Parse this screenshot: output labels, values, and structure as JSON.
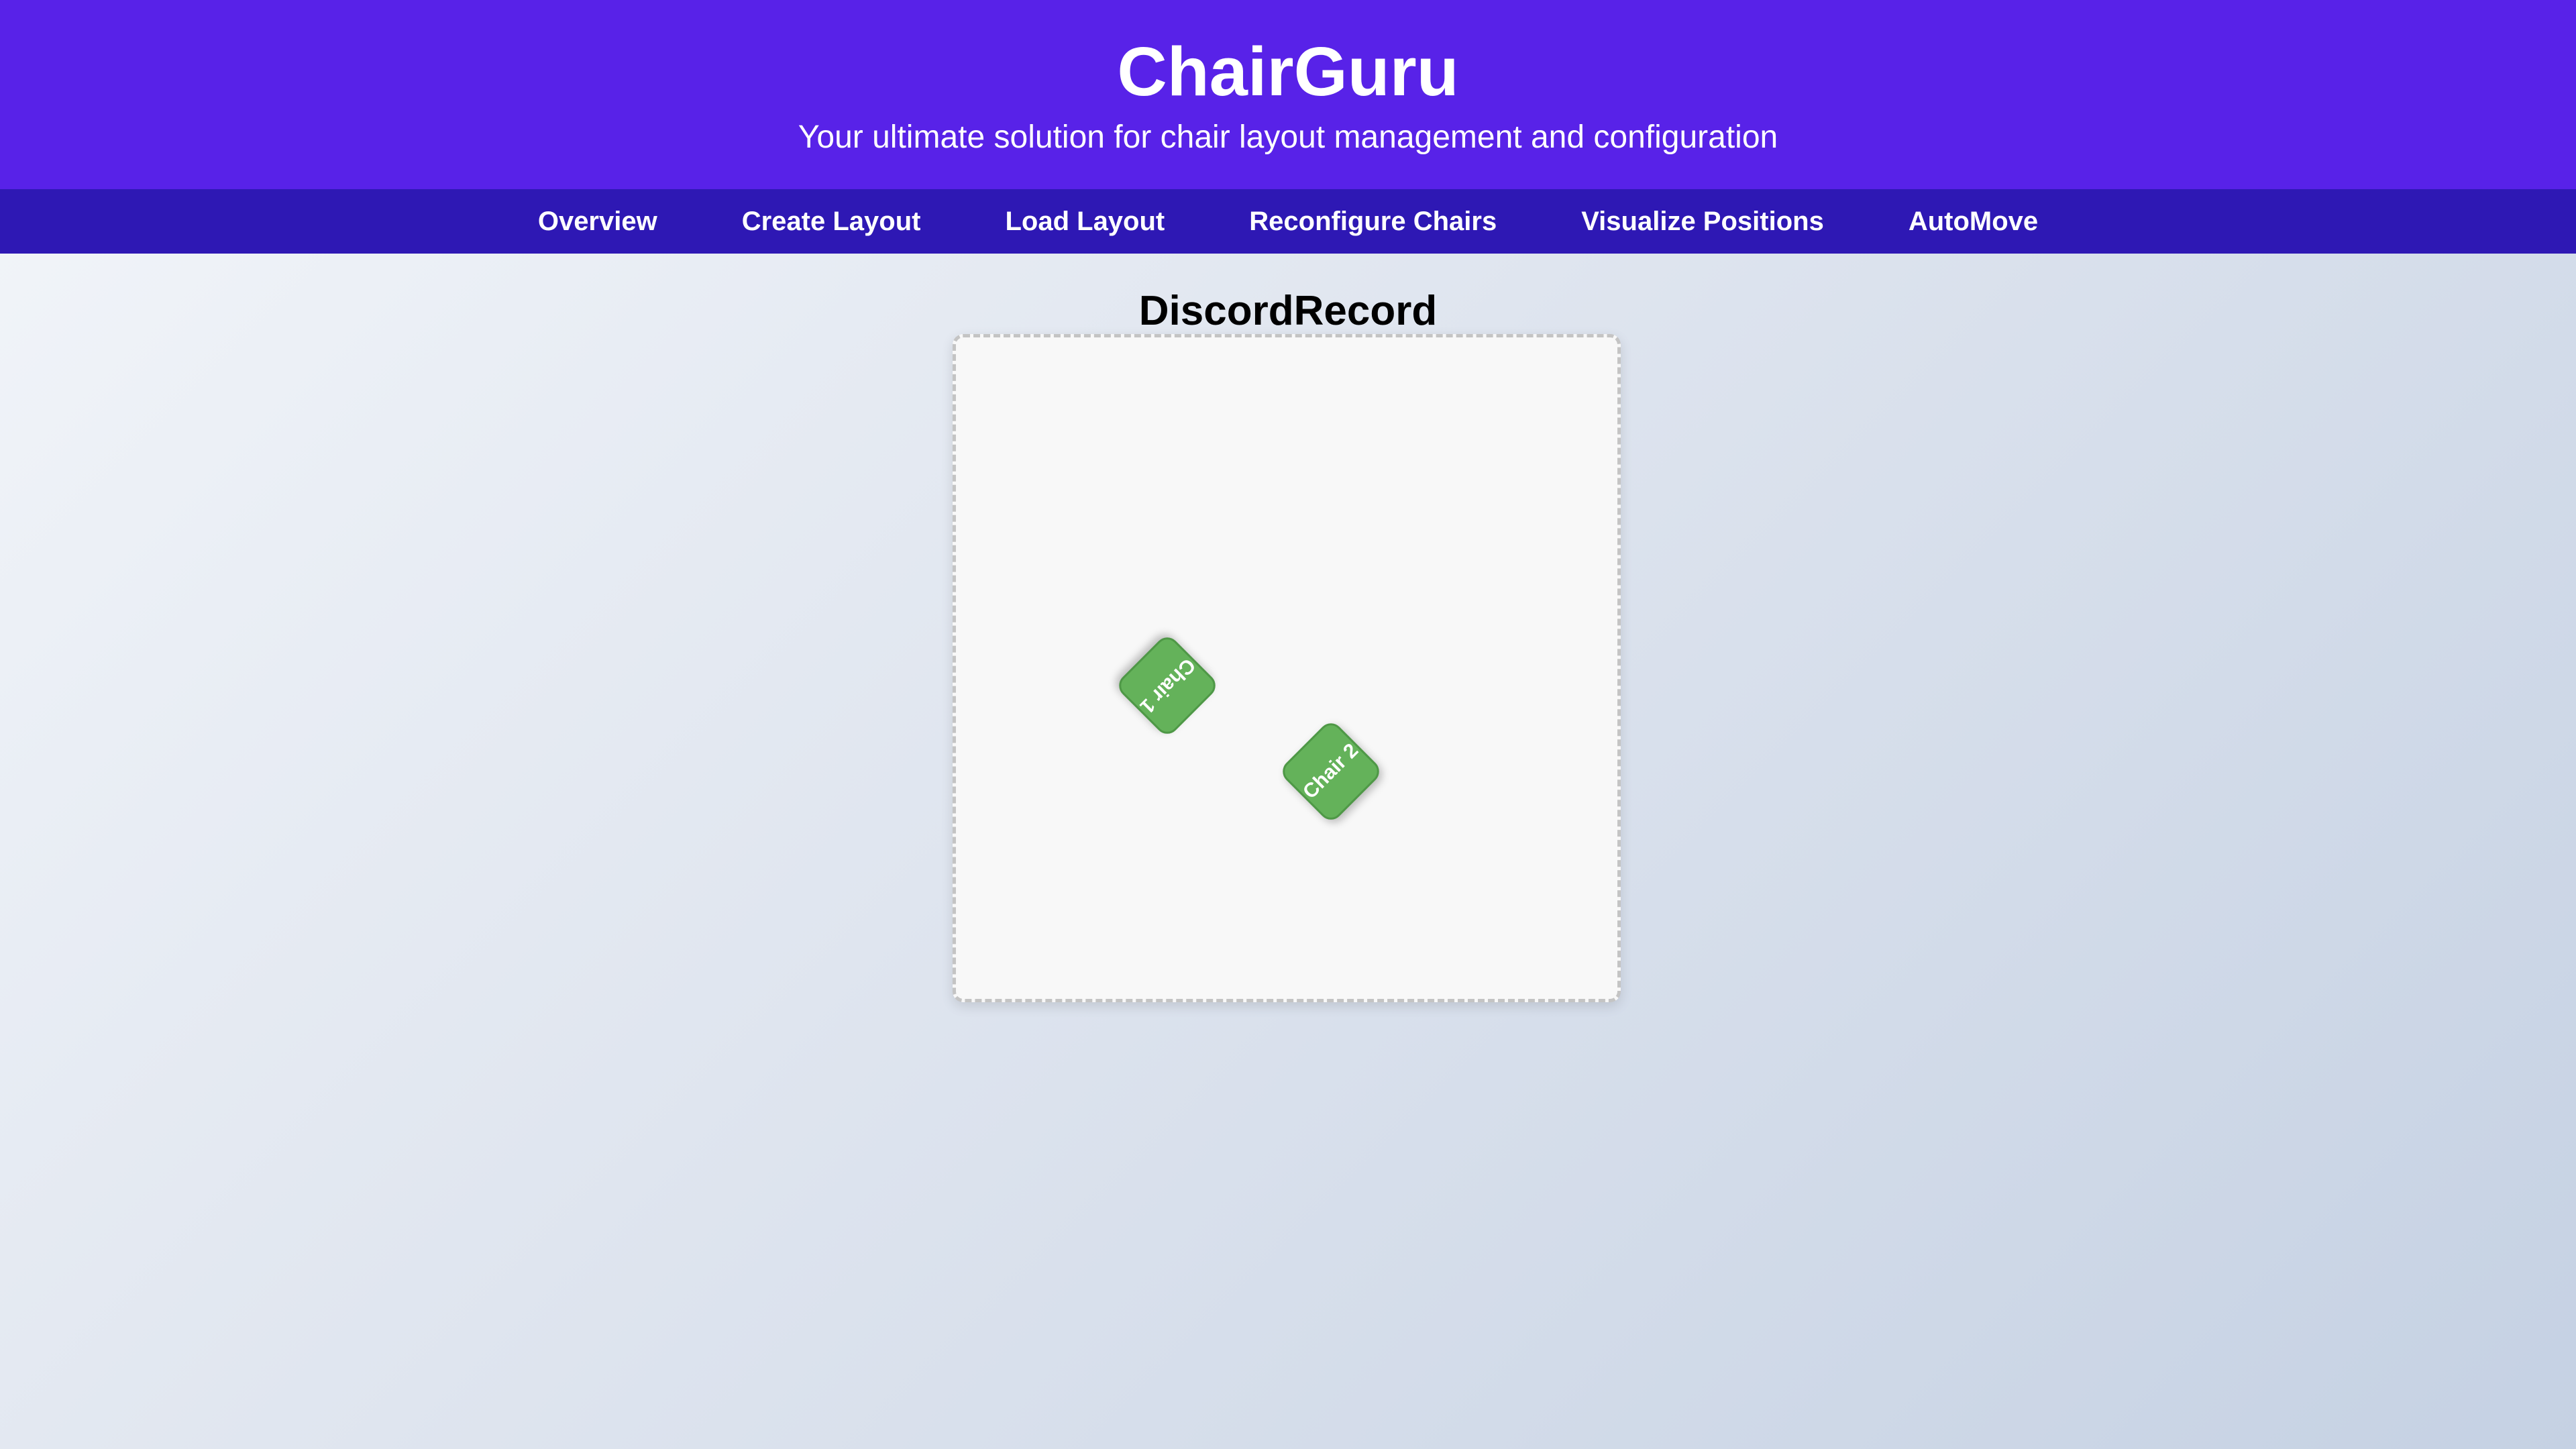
{
  "header": {
    "title": "ChairGuru",
    "tagline": "Your ultimate solution for chair layout management and configuration"
  },
  "nav": {
    "items": [
      {
        "label": "Overview"
      },
      {
        "label": "Create Layout"
      },
      {
        "label": "Load Layout"
      },
      {
        "label": "Reconfigure Chairs"
      },
      {
        "label": "Visualize Positions"
      },
      {
        "label": "AutoMove"
      }
    ]
  },
  "layout": {
    "name": "DiscordRecord",
    "chairs": [
      {
        "label": "Chair 1"
      },
      {
        "label": "Chair 2"
      }
    ]
  },
  "colors": {
    "header_bg": "#5822e8",
    "nav_bg": "#2e18b4",
    "chair_fill": "#64b25a"
  }
}
